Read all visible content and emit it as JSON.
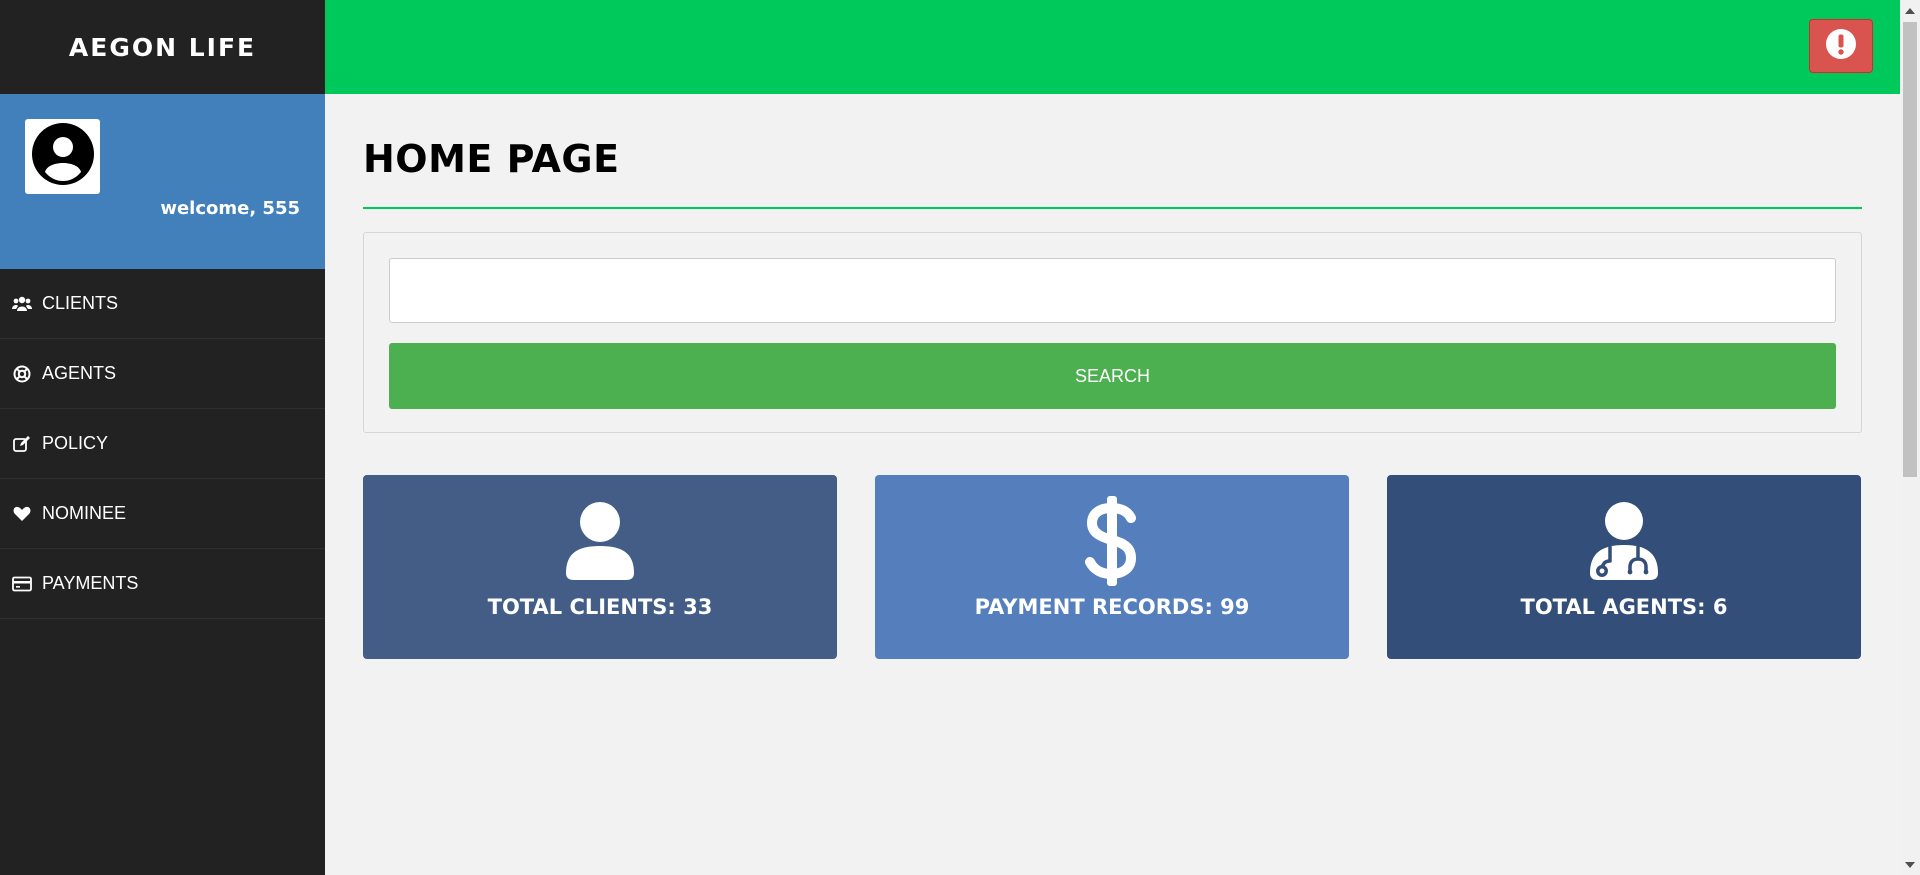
{
  "brand": {
    "title": "AEGON LIFE"
  },
  "profile": {
    "welcome": "welcome, 555",
    "avatar_icon": "user-circle-icon"
  },
  "sidebar": {
    "items": [
      {
        "label": "CLIENTS",
        "icon": "users-icon"
      },
      {
        "label": "AGENTS",
        "icon": "life-ring-icon"
      },
      {
        "label": "POLICY",
        "icon": "edit-icon"
      },
      {
        "label": "NOMINEE",
        "icon": "heart-icon"
      },
      {
        "label": "PAYMENTS",
        "icon": "credit-card-icon"
      }
    ]
  },
  "topbar": {
    "alert_icon": "exclamation-circle-icon"
  },
  "main": {
    "title": "HOME PAGE",
    "search": {
      "value": "",
      "placeholder": "",
      "button_label": "SEARCH"
    },
    "cards": [
      {
        "label": "TOTAL CLIENTS: 33",
        "icon": "user-icon",
        "color": "#435d87"
      },
      {
        "label": "PAYMENT RECORDS: 99",
        "icon": "dollar-icon",
        "color": "#557ebd"
      },
      {
        "label": "TOTAL AGENTS: 6",
        "icon": "user-doctor-icon",
        "color": "#344e7a"
      }
    ]
  },
  "colors": {
    "sidebar_bg": "#222222",
    "profile_bg": "#4280bc",
    "topbar_bg": "#00c95c",
    "search_button": "#4caf50",
    "alert_button": "#d9534f"
  }
}
